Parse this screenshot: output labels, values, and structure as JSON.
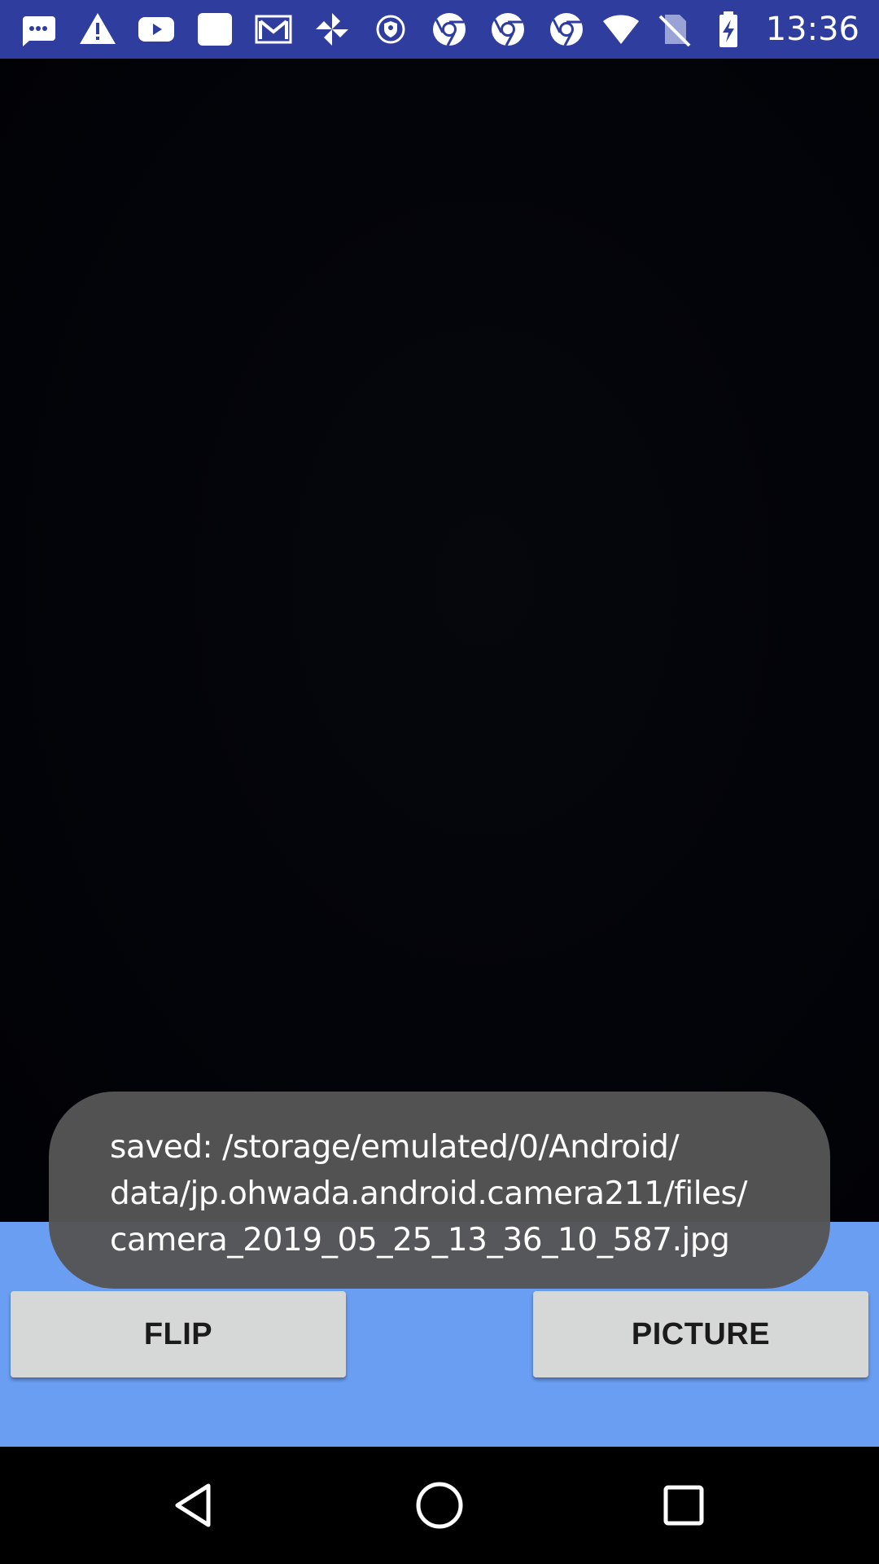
{
  "status_bar": {
    "time": "13:36",
    "left_icons": [
      "message-icon",
      "warning-icon",
      "youtube-icon",
      "square-app-icon",
      "gmail-icon",
      "pinwheel-icon",
      "vpn-shield-icon",
      "chrome-icon",
      "chrome-icon",
      "chrome-icon"
    ],
    "right_icons": [
      "wifi-icon",
      "no-sim-icon",
      "battery-charging-icon"
    ],
    "background_color": "#2f3e9e"
  },
  "toast": {
    "message": "saved: /storage/emulated/0/Android/\ndata/jp.ohwada.android.camera211/files/\ncamera_2019_05_25_13_36_10_587.jpg"
  },
  "controls": {
    "flip_label": "FLIP",
    "picture_label": "PICTURE",
    "background_color": "#6a9ef2"
  },
  "nav_bar": {
    "icons": [
      "back-icon",
      "home-icon",
      "recents-icon"
    ]
  }
}
